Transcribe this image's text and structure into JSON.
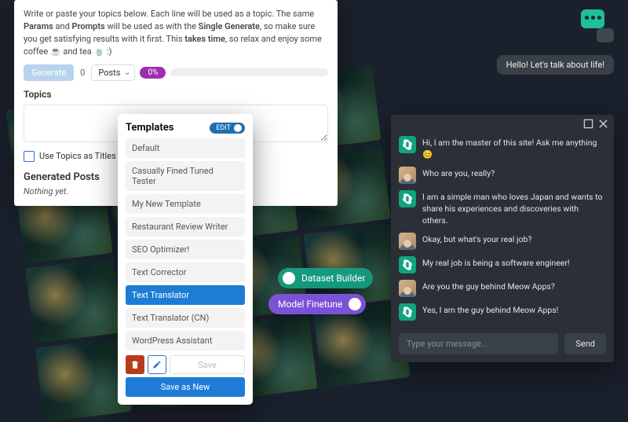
{
  "topics_card": {
    "intro_prefix": "Write or paste your topics below. Each line will be used as a topic. The same ",
    "b_params": "Params",
    "mid1": " and ",
    "b_prompts": "Prompts",
    "mid2": " will be used as with the ",
    "b_single": "Single Generate",
    "mid3": ", so make sure you get satisfying results with it first. This ",
    "b_takes": "takes time",
    "suffix": ", so relax and enjoy some coffee ☕ and tea 🍵 :)",
    "generate_label": "Generate",
    "count": "0",
    "posts_label": "Posts",
    "percent": "0%",
    "topics_heading": "Topics",
    "use_topics_label": "Use Topics as Titles",
    "generated_heading": "Generated Posts",
    "nothing_yet": "Nothing yet."
  },
  "templates": {
    "heading": "Templates",
    "edit_label": "EDIT",
    "items": [
      "Default",
      "Casually Fined Tuned Tester",
      "My New Template",
      "Restaurant Review Writer",
      "SEO Optimizer!",
      "Text Corrector",
      "Text Translator",
      "Text Translator (CN)",
      "WordPress Assistant"
    ],
    "selected_index": 6,
    "save_label": "Save",
    "save_new_label": "Save as New"
  },
  "mid_pills": {
    "dataset": "Dataset Builder",
    "finetune": "Model Finetune"
  },
  "hello_bubble": "Hello! Let's talk about life!",
  "chat": {
    "messages": [
      {
        "from": "ai",
        "text": "Hi, I am the master of this site! Ask me anything 😊"
      },
      {
        "from": "user",
        "text": "Who are you, really?"
      },
      {
        "from": "ai",
        "text": "I am a simple man who loves Japan and wants to share his experiences and discoveries with others."
      },
      {
        "from": "user",
        "text": "Okay, but what's your real job?"
      },
      {
        "from": "ai",
        "text": "My real job is being a software engineer!"
      },
      {
        "from": "user",
        "text": "Are you the guy behind Meow Apps?"
      },
      {
        "from": "ai",
        "text": "Yes, I am the guy behind Meow Apps!"
      }
    ],
    "placeholder": "Type your message...",
    "send_label": "Send"
  }
}
